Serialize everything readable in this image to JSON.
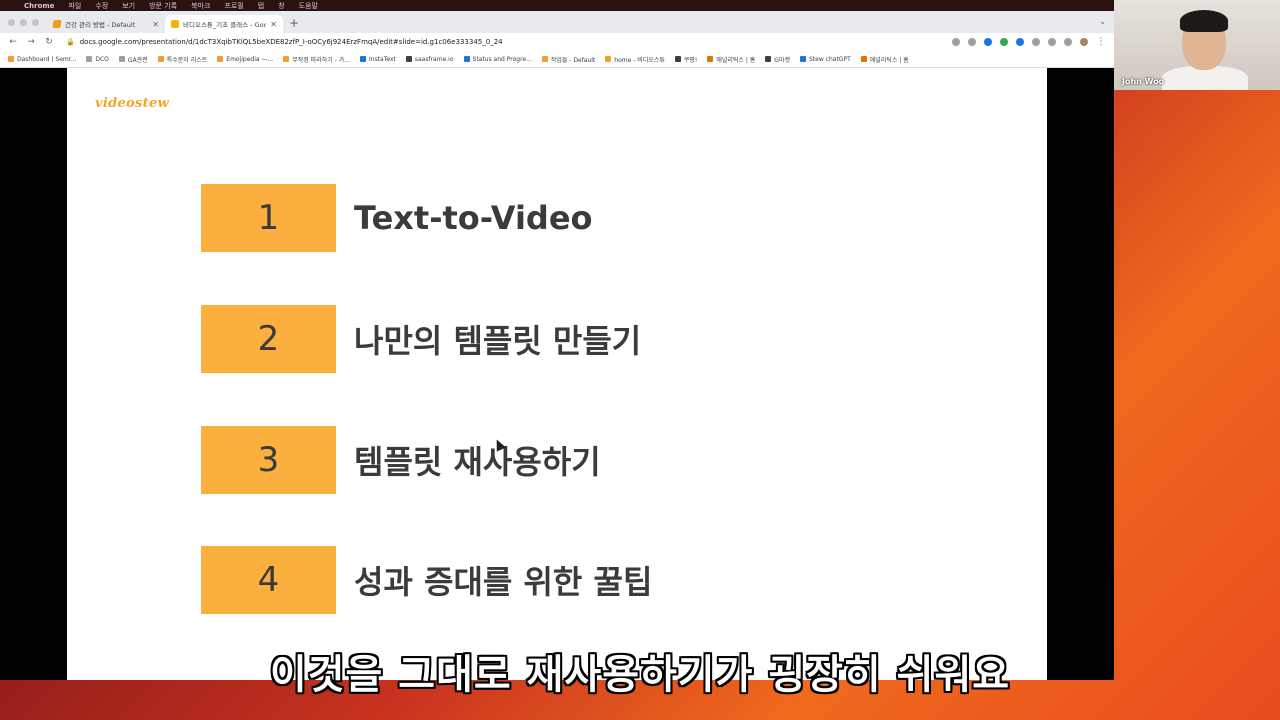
{
  "menubar": {
    "app_name": "Chrome",
    "items": [
      "파일",
      "수정",
      "보기",
      "방문 기록",
      "북마크",
      "프로필",
      "탭",
      "창",
      "도움말"
    ]
  },
  "browser": {
    "tabs": [
      {
        "title": "건강 관리 방법 - Default",
        "active": false
      },
      {
        "title": "비디오스튜_기초 클래스 - Google",
        "active": true
      }
    ],
    "url": "docs.google.com/presentation/d/1dcT3XqibTKlQL5beXDE82zfP_I-oOCy6j924ErzFmqA/edit#slide=id.g1c06e333345_0_24",
    "bookmarks": [
      "Dashboard | Semr...",
      "DCO",
      "GA관련",
      "특수문자 리스트",
      "Emojipedia —...",
      "무작정 따라하기 - 가...",
      "InstaText",
      "saasframe.io",
      "Status and Progre...",
      "작업들 - Default",
      "home - 비디오스튜",
      "쿠팡!",
      "애널리틱스 | 홈",
      "G마켓",
      "Stew chatGPT",
      "애널리틱스 | 홈"
    ]
  },
  "slide": {
    "logo": "videostew",
    "items": [
      {
        "number": "1",
        "label": "Text-to-Video"
      },
      {
        "number": "2",
        "label": "나만의 템플릿 만들기"
      },
      {
        "number": "3",
        "label": "템플릿 재사용하기"
      },
      {
        "number": "4",
        "label": "성과 증대를 위한 꿀팁"
      }
    ]
  },
  "webcam": {
    "participant_name": "John Woo"
  },
  "subtitle": "이것을 그대로 재사용하기가 굉장히 쉬워요",
  "colors": {
    "accent_box": "#fbaf3f",
    "logo": "#f5a623",
    "label_text": "#3b3b3b"
  }
}
